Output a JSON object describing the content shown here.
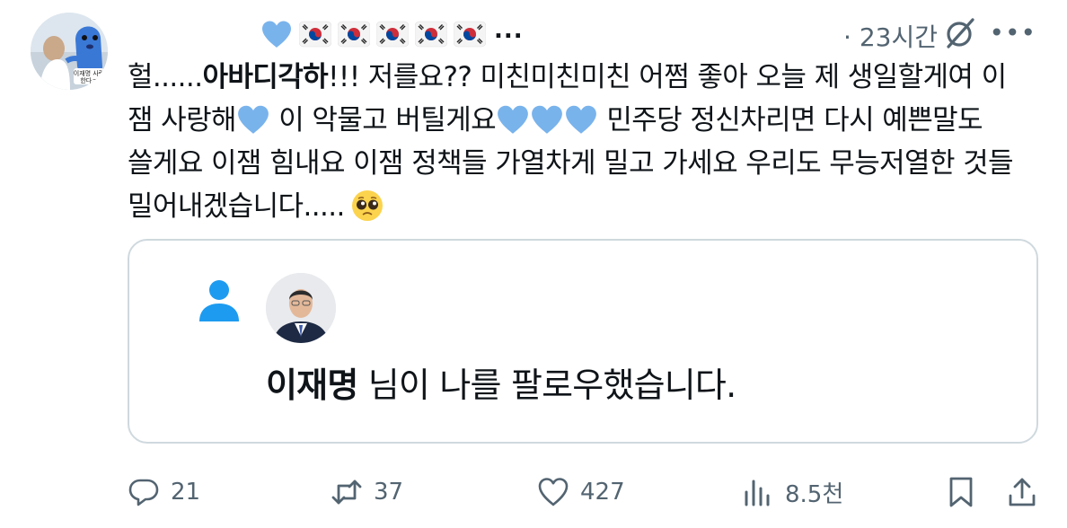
{
  "author": {
    "time": "· 23시간",
    "name_suffix": "...",
    "avatar_label": "이재명 사랑 한다ㄱ"
  },
  "tweet": {
    "line1_a": "헐......",
    "line1_b": "아바디각하",
    "line1_c": "!!! 저를요?? 미친미친미친 어쩜 좋아 오늘 제 생일할게여 이",
    "line2_a": "잼 사랑해",
    "line2_b": " 이 악물고 버틸게요",
    "line2_c": " 민주당 정신차리면 다시 예쁜말도",
    "line3": "쓸게요 이잼 힘내요 이잼 정책들 가열차게 밀고 가세요 우리도 무능저열한 것들",
    "line4": "밀어내겠습니다....."
  },
  "card": {
    "follower_name": "이재명",
    "follow_text": " 님이 나를 팔로우했습니다."
  },
  "actions": {
    "replies": "21",
    "retweets": "37",
    "likes": "427",
    "views": "8.5천"
  },
  "colors": {
    "heart": "#79b3ec",
    "follow_icon": "#1d9bf0",
    "secondary_text": "#536471",
    "card_border": "#cfd9de"
  },
  "icons": [
    "heart-icon",
    "korea-flag-icon",
    "grok-icon",
    "more-icon",
    "person-icon",
    "reply-icon",
    "retweet-icon",
    "like-icon",
    "views-icon",
    "bookmark-icon",
    "share-icon",
    "pleading-face-icon"
  ]
}
